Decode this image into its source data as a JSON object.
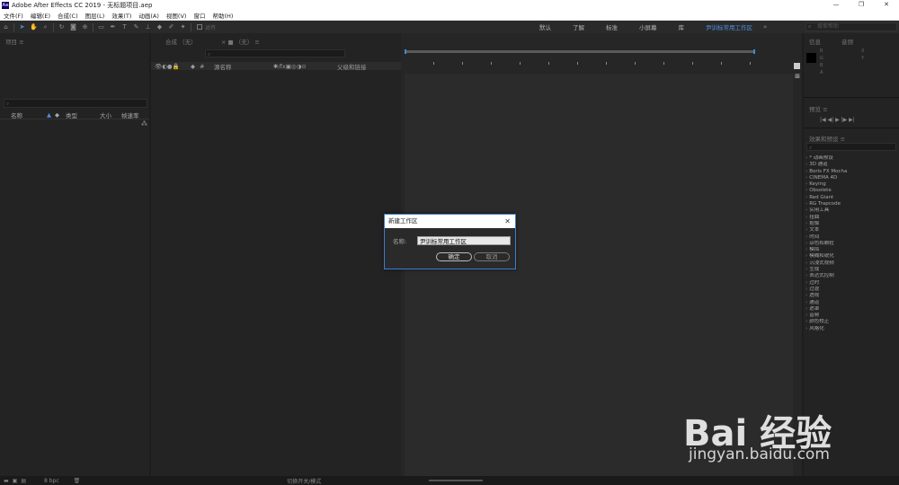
{
  "titlebar": {
    "app_icon": "Ae",
    "title": "Adobe After Effects CC 2019 - 无标题项目.aep",
    "minimize": "—",
    "restore": "❐",
    "close": "✕"
  },
  "menu": [
    "文件(F)",
    "编辑(E)",
    "合成(C)",
    "图层(L)",
    "效果(T)",
    "动画(A)",
    "视图(V)",
    "窗口",
    "帮助(H)"
  ],
  "toolbar": {
    "snap_label": "对齐",
    "workspaces": [
      "默认",
      "了解",
      "标准",
      "小屏幕",
      "库"
    ],
    "active_workspace": "尹训标常用工作区",
    "search_placeholder": "搜索帮助"
  },
  "project": {
    "tab": "项目  ≡",
    "columns": [
      "名称",
      "类型",
      "大小",
      "帧速率"
    ]
  },
  "timeline": {
    "tab_comp": "合成 （无）",
    "tab_layer": "× ■ （无） ≡",
    "col_source": "源名称",
    "col_parent": "父级和链接"
  },
  "info": {
    "tabs": [
      "信息",
      "音频"
    ],
    "channels": [
      "R",
      "G",
      "B",
      "A"
    ],
    "xy": [
      "X",
      "Y"
    ]
  },
  "preview": {
    "tab": "预览  ≡",
    "controls": "|◀  ◀|  ▶  |▶  ▶|"
  },
  "effects": {
    "tab": "效果和预设  ≡",
    "items": [
      "* 动画预设",
      "3D 通道",
      "Boris FX Mocha",
      "CINEMA 4D",
      "Keying",
      "Obsolete",
      "Red Giant",
      "RG Trapcode",
      "实用工具",
      "扭曲",
      "抠像",
      "文本",
      "时间",
      "杂色和颗粒",
      "模拟",
      "模糊和锐化",
      "沉浸式视频",
      "生成",
      "表达式控制",
      "过时",
      "过渡",
      "透视",
      "通道",
      "遮罩",
      "音频",
      "颜色校正",
      "风格化"
    ]
  },
  "status": {
    "bpc": "8 bpc",
    "toggle": "切换开关/模式"
  },
  "dialog": {
    "title": "新建工作区",
    "name_label": "名称:",
    "name_value": "尹训标常用工作区",
    "ok": "确定",
    "cancel": "取消"
  },
  "watermark": {
    "logo": "Bai 经验",
    "url": "jingyan.baidu.com"
  }
}
